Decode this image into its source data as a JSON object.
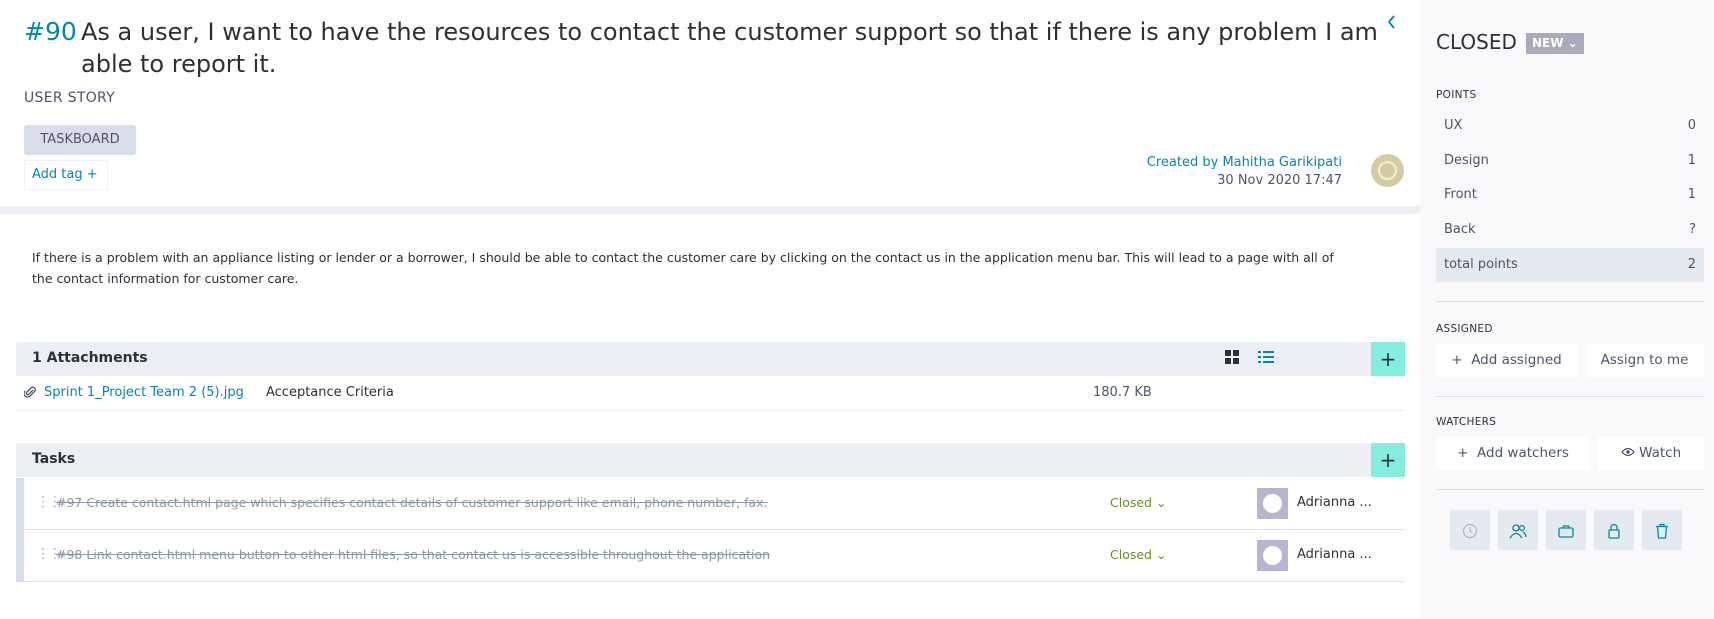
{
  "story": {
    "ref": "#90",
    "subject": "As a user, I want to have the resources to contact the customer support so that if there is any problem I am able to report it.",
    "type": "USER STORY",
    "tags": [
      "TASKBOARD"
    ],
    "add_tag": "Add tag",
    "created_prefix": "Created by",
    "created_by": "Mahitha Garikipati",
    "created_date": "30 Nov 2020 17:47",
    "description": "If there is a problem with an appliance listing or lender or a borrower, I should be able to contact the customer care by clicking on the contact us in the application menu bar. This will lead to a page with all of the contact information for customer care."
  },
  "attachments": {
    "title": "1 Attachments",
    "items": [
      {
        "name": "Sprint 1_Project Team 2 (5).jpg",
        "description": "Acceptance Criteria",
        "size": "180.7 KB"
      }
    ]
  },
  "tasks": {
    "title": "Tasks",
    "items": [
      {
        "ref": "#97",
        "text": "Create contact.html page which specifies contact details of customer support like email, phone number, fax.",
        "status": "Closed",
        "assignee": "Adrianna ..."
      },
      {
        "ref": "#98",
        "text": "Link contact.html menu button to other html files, so that contact us is accessible throughout the application",
        "status": "Closed",
        "assignee": "Adrianna ..."
      }
    ]
  },
  "sidebar": {
    "status": "CLOSED",
    "badge": "NEW",
    "points_label": "POINTS",
    "points": [
      {
        "name": "UX",
        "value": "0"
      },
      {
        "name": "Design",
        "value": "1"
      },
      {
        "name": "Front",
        "value": "1"
      },
      {
        "name": "Back",
        "value": "?"
      }
    ],
    "total": {
      "name": "total points",
      "value": "2"
    },
    "assigned_label": "ASSIGNED",
    "add_assigned": "Add assigned",
    "assign_to_me": "Assign to me",
    "watchers_label": "WATCHERS",
    "add_watchers": "Add watchers",
    "watch": "Watch"
  },
  "colors": {
    "accent": "#008aa8",
    "add_button": "#83eede",
    "closed_status": "#6b8e23"
  }
}
